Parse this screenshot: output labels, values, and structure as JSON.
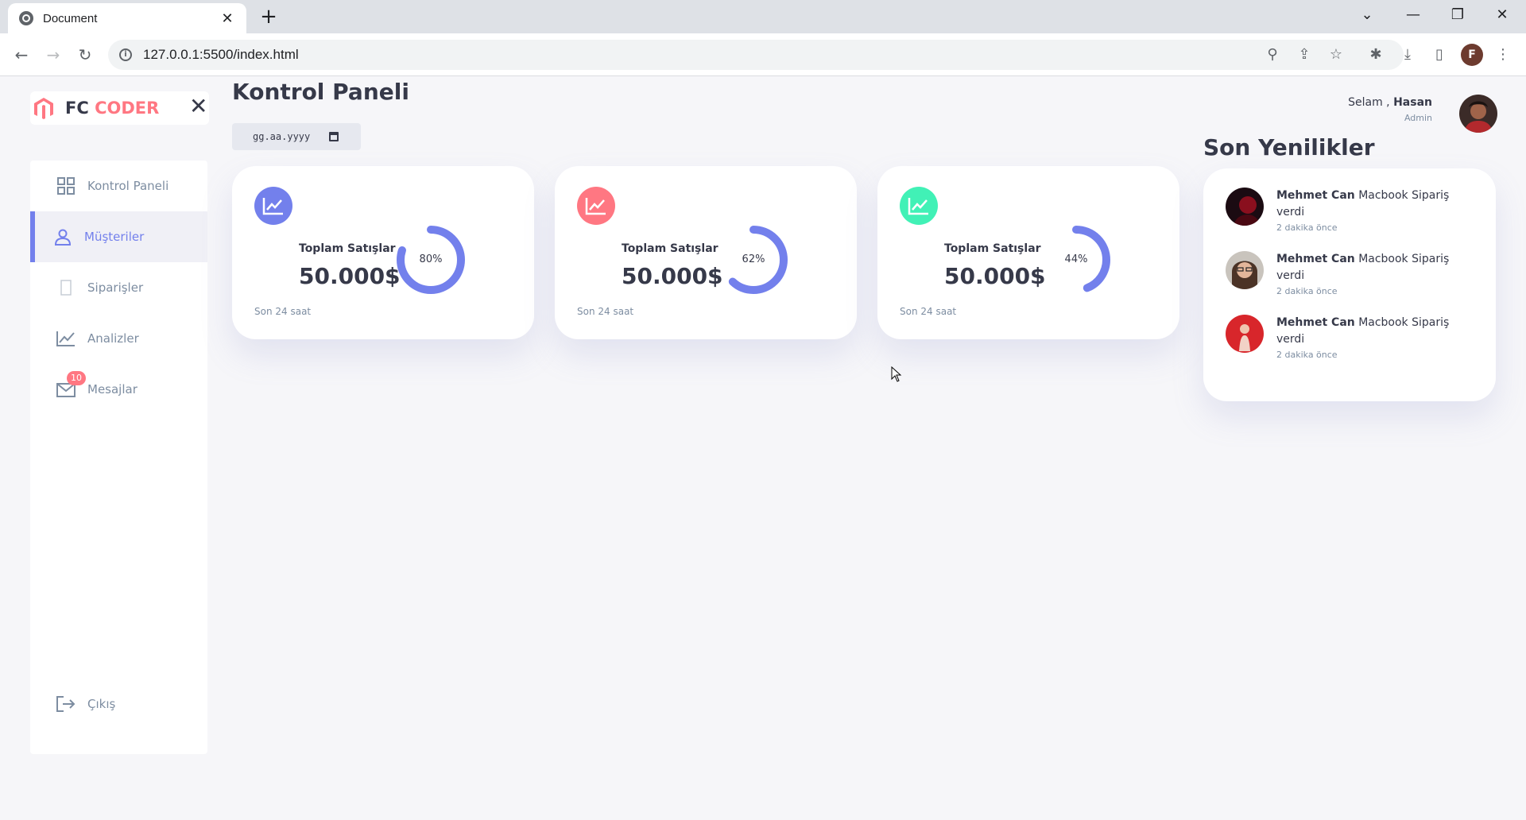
{
  "browser": {
    "tab_title": "Document",
    "tab_close": "✕",
    "new_tab": "+",
    "url": "127.0.0.1:5500/index.html",
    "profile_initial": "F",
    "window_controls": [
      "⌄",
      "—",
      "❐",
      "✕"
    ]
  },
  "brand": {
    "prefix": "FC",
    "accent": "CODER",
    "close_label": "✕",
    "accent_color": "#ff7782"
  },
  "sidebar": {
    "items": [
      {
        "label": "Kontrol Paneli",
        "icon": "grid-icon"
      },
      {
        "label": "Müşteriler",
        "icon": "person-icon",
        "active": true
      },
      {
        "label": "Siparişler",
        "icon": "receipt-icon"
      },
      {
        "label": "Analizler",
        "icon": "insights-icon"
      },
      {
        "label": "Mesajlar",
        "icon": "mail-icon",
        "badge": "10"
      }
    ],
    "logout": {
      "label": "Çıkış",
      "icon": "logout-icon"
    }
  },
  "header": {
    "title": "Kontrol Paneli",
    "date_placeholder": "gg.aa.yyyy"
  },
  "cards": [
    {
      "label": "Toplam Satışlar",
      "value": "50.000$",
      "subtitle": "Son 24 saat",
      "percent": "80%",
      "progress": 0.8,
      "icon_color": "#7380ec"
    },
    {
      "label": "Toplam Satışlar",
      "value": "50.000$",
      "subtitle": "Son 24 saat",
      "percent": "62%",
      "progress": 0.62,
      "icon_color": "#ff7782"
    },
    {
      "label": "Toplam Satışlar",
      "value": "50.000$",
      "subtitle": "Son 24 saat",
      "percent": "44%",
      "progress": 0.44,
      "icon_color": "#41f1b6"
    }
  ],
  "user": {
    "greeting": "Selam ,",
    "name": "Hasan",
    "role": "Admin"
  },
  "updates": {
    "title": "Son Yenilikler",
    "items": [
      {
        "name": "Mehmet Can",
        "message": "Macbook Sipariş verdi",
        "time": "2 dakika önce"
      },
      {
        "name": "Mehmet Can",
        "message": "Macbook Sipariş verdi",
        "time": "2 dakika önce"
      },
      {
        "name": "Mehmet Can",
        "message": "Macbook Sipariş verdi",
        "time": "2 dakika önce"
      }
    ]
  },
  "colors": {
    "primary": "#7380ec",
    "danger": "#ff7782",
    "success": "#41f1b6",
    "dark": "#363949",
    "muted": "#7d8da1"
  }
}
